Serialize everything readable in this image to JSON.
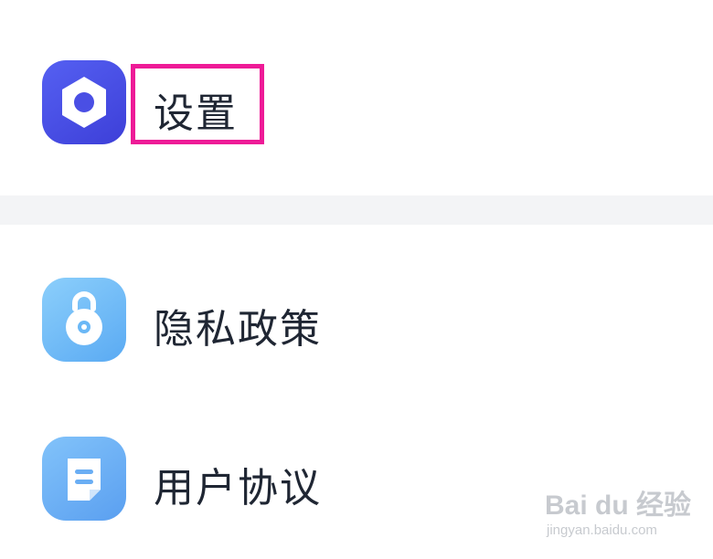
{
  "menu": {
    "items": [
      {
        "label": "设置",
        "icon": "settings-hex-nut-icon",
        "icon_color": "#4a50e6"
      },
      {
        "label": "隐私政策",
        "icon": "privacy-lock-icon",
        "icon_color": "#6bb8f6"
      },
      {
        "label": "用户协议",
        "icon": "user-agreement-document-icon",
        "icon_color": "#6aaef4"
      }
    ]
  },
  "annotation": {
    "color": "#ee1b97"
  },
  "watermark": {
    "logo": "Bai du 经验",
    "url": "jingyan.baidu.com"
  }
}
